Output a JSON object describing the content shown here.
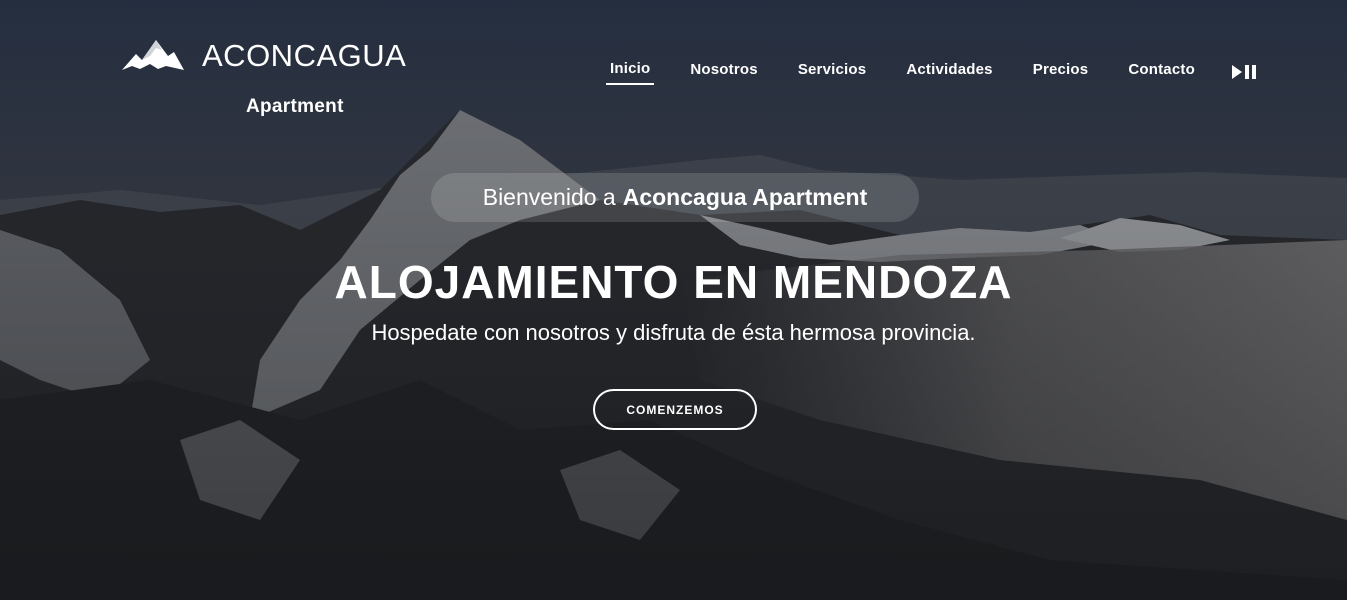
{
  "brand": {
    "logo_icon": "mountain-icon",
    "name": "ACONCAGUA",
    "subtitle": "Apartment"
  },
  "nav": {
    "items": [
      {
        "label": "Inicio",
        "active": true
      },
      {
        "label": "Nosotros",
        "active": false
      },
      {
        "label": "Servicios",
        "active": false
      },
      {
        "label": "Actividades",
        "active": false
      },
      {
        "label": "Precios",
        "active": false
      },
      {
        "label": "Contacto",
        "active": false
      }
    ],
    "media_icon": "play-pause-icon"
  },
  "hero": {
    "welcome_prefix": "Bienvenido a",
    "welcome_brand": "Aconcagua Apartment",
    "headline": "ALOJAMIENTO EN MENDOZA",
    "subheadline": "Hospedate con nosotros y disfruta de ésta hermosa provincia.",
    "cta_label": "COMENZEMOS"
  },
  "colors": {
    "text": "#ffffff",
    "sky_top": "#2a3446",
    "mountain_dark": "#1f2226",
    "snow": "#c9ccd1"
  }
}
